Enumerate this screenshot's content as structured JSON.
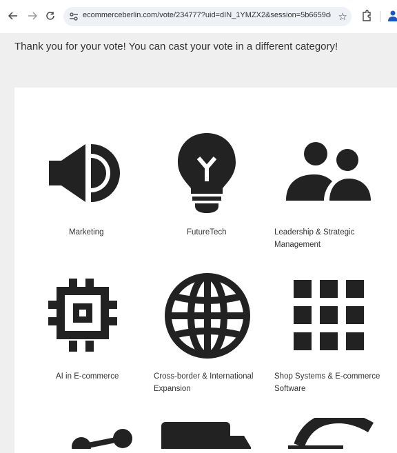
{
  "browser": {
    "url": "ecommerceberlin.com/vote/234777?uid=dIN_1YMZX2&session=5b6659dc..."
  },
  "page": {
    "message": "Thank you for your vote! You can cast your vote in a different category!"
  },
  "categories": [
    {
      "label": "Marketing",
      "icon": "speaker-icon"
    },
    {
      "label": "FutureTech",
      "icon": "lightbulb-icon"
    },
    {
      "label": "Leadership & Strategic Management",
      "icon": "people-icon"
    },
    {
      "label": "AI in E-commerce",
      "icon": "chip-icon"
    },
    {
      "label": "Cross-border & International Expansion",
      "icon": "globe-icon"
    },
    {
      "label": "Shop Systems & E-commerce Software",
      "icon": "grid-icon"
    }
  ]
}
